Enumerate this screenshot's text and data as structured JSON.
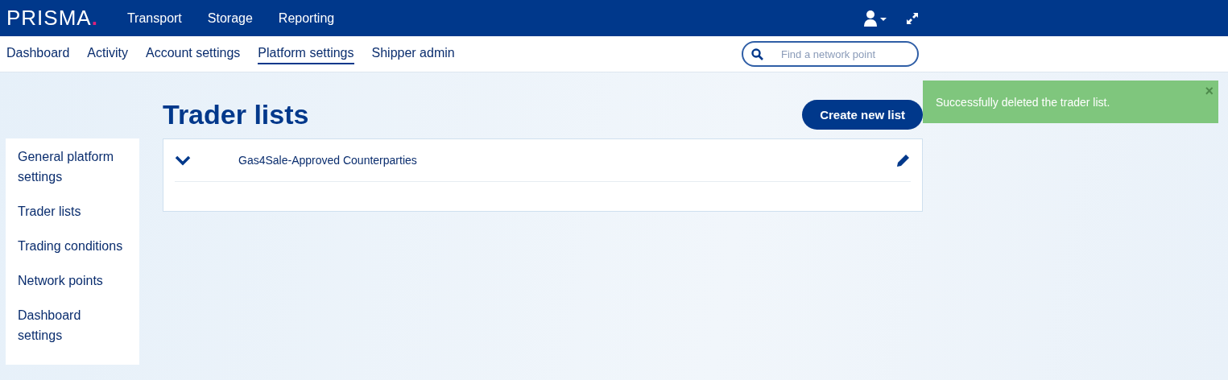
{
  "logo": {
    "text": "PRISMA",
    "dot": "."
  },
  "main_nav": [
    "Transport",
    "Storage",
    "Reporting"
  ],
  "sub_nav": [
    {
      "label": "Dashboard",
      "selected": false
    },
    {
      "label": "Activity",
      "selected": false
    },
    {
      "label": "Account settings",
      "selected": false
    },
    {
      "label": "Platform settings",
      "selected": true
    },
    {
      "label": "Shipper admin",
      "selected": false
    }
  ],
  "search": {
    "placeholder": "Find a network point"
  },
  "sidebar": {
    "items": [
      "General platform settings",
      "Trader lists",
      "Trading conditions",
      "Network points",
      "Dashboard settings"
    ]
  },
  "page": {
    "title": "Trader lists",
    "create_button": "Create new list"
  },
  "lists": [
    {
      "name": "Gas4Sale-Approved Counterparties",
      "expanded": true
    }
  ],
  "toast": {
    "message": "Successfully deleted the trader list.",
    "close": "×"
  }
}
